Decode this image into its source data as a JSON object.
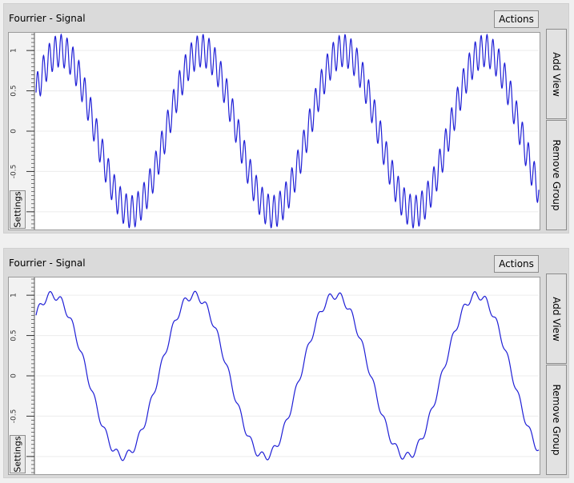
{
  "panels": [
    {
      "title": "Fourrier - Signal",
      "actions_label": "Actions",
      "add_view_label": "Add View",
      "remove_group_label": "Remove Group",
      "settings_label": "Settings",
      "line_color": "#1f1fd6",
      "chart_data": {
        "type": "line",
        "yticks": [
          "1",
          "0.5",
          "0",
          "-0.5",
          "-1"
        ],
        "ytick_values": [
          1,
          0.5,
          0,
          -0.5,
          -1
        ],
        "ylim": [
          -1.2,
          1.2
        ],
        "grid": true,
        "signal": {
          "components": [
            {
              "amplitude": 1.0,
              "cycles": 3.55,
              "phase": 0.5
            },
            {
              "amplitude": 0.2,
              "cycles": 85,
              "phase": 0
            }
          ]
        }
      }
    },
    {
      "title": "Fourrier - Signal",
      "actions_label": "Actions",
      "add_view_label": "Add View",
      "remove_group_label": "Remove Group",
      "settings_label": "Settings",
      "line_color": "#1f1fd6",
      "chart_data": {
        "type": "line",
        "yticks": [
          "1",
          "0.5",
          "0",
          "-0.5",
          "-1"
        ],
        "ytick_values": [
          1,
          0.5,
          0,
          -0.5,
          -1
        ],
        "ylim": [
          -1.2,
          1.2
        ],
        "grid": true,
        "signal": {
          "components": [
            {
              "amplitude": 1.0,
              "cycles": 3.55,
              "phase": 0.85
            },
            {
              "amplitude": 0.05,
              "cycles": 45,
              "phase": 0
            }
          ]
        }
      }
    }
  ]
}
